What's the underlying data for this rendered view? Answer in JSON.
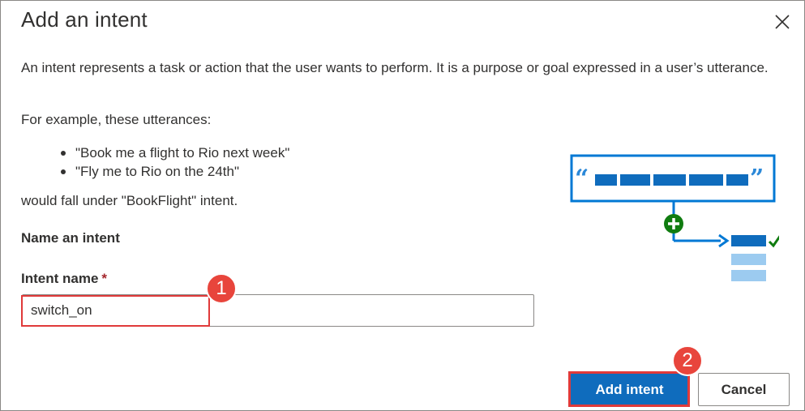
{
  "dialog": {
    "title": "Add an intent",
    "close_icon": "close-icon",
    "description": "An intent represents a task or action that the user wants to perform. It is a purpose or goal expressed in a user’s utterance.",
    "example_intro": "For example, these utterances:",
    "examples": [
      "\"Book me a flight to Rio next week\"",
      "\"Fly me to Rio on the 24th\""
    ],
    "fall_text": "would fall under \"BookFlight\" intent.",
    "section_label": "Name an intent",
    "field_label": "Intent name",
    "required_marker": "*",
    "intent_value": "switch_on",
    "add_button": "Add intent",
    "cancel_button": "Cancel"
  },
  "annotations": {
    "step1": "1",
    "step2": "2",
    "highlight_color": "#e03a3a"
  },
  "colors": {
    "primary": "#0f6cbd",
    "illustration_blue": "#0078d4",
    "illustration_green": "#107c10"
  }
}
